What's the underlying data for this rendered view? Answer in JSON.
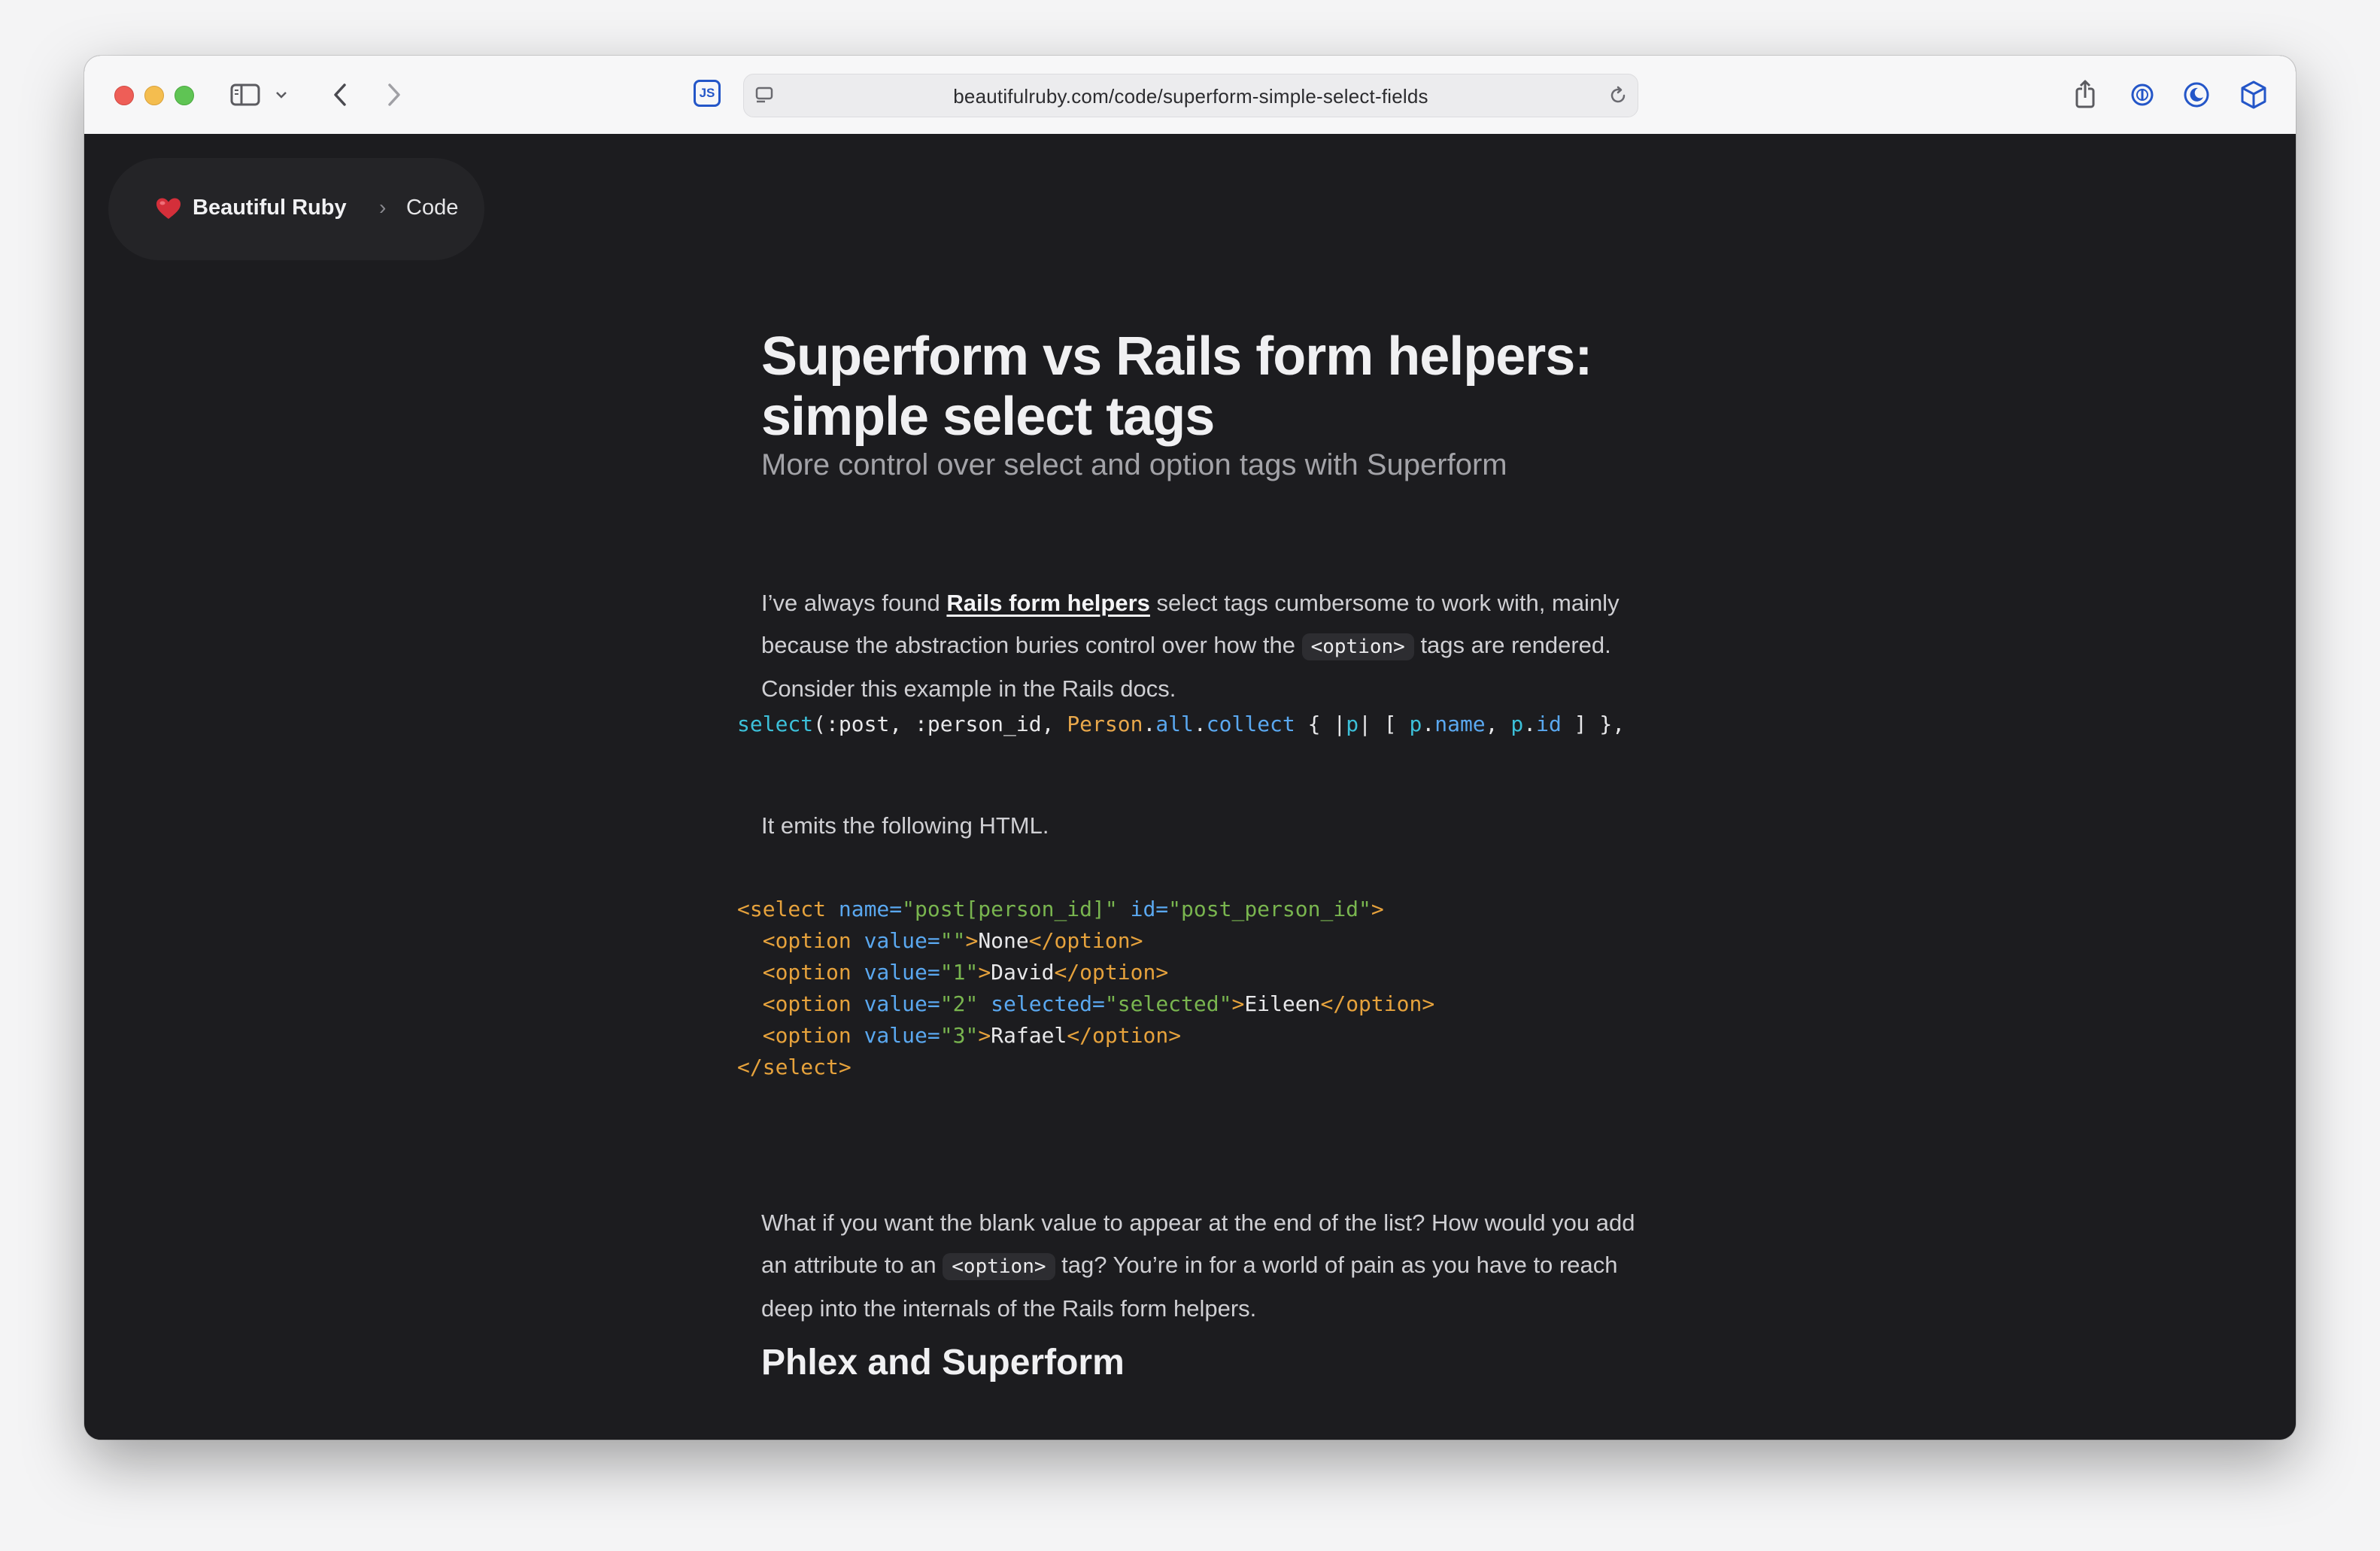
{
  "browser": {
    "url": "beautifulruby.com/code/superform-simple-select-fields",
    "js_badge": "JS",
    "icons": [
      "sidebar-icon",
      "chevron-down-icon",
      "back-icon",
      "forward-icon",
      "page-settings-icon",
      "reload-icon",
      "share-icon",
      "password-icon",
      "dark-mode-icon",
      "extension-cube-icon"
    ]
  },
  "breadcrumb": {
    "brand": "Beautiful Ruby",
    "separator": "›",
    "current": "Code"
  },
  "article": {
    "title": "Superform vs Rails form helpers: simple select tags",
    "subtitle": "More control over select and option tags with Superform",
    "p1": {
      "before": "I’ve always found ",
      "link": "Rails form helpers",
      "middle": " select tags cumbersome to work with, mainly because the abstraction buries control over how the ",
      "code": "<option>",
      "after": " tags are rendered. Consider this example in the Rails docs."
    },
    "code1": {
      "fn": "select",
      "args": "(:post, :person_id, ",
      "const": "Person",
      "dot1": ".",
      "m1": "all",
      "dot2": ".",
      "m2": "collect",
      "block_open": " { |",
      "bp": "p",
      "block_mid": "| [ ",
      "p1": "p",
      "d3": ".",
      "m3": "name",
      "comma": ", ",
      "p2": "p",
      "d4": ".",
      "m4": "id",
      "close": " ] },"
    },
    "p2": "It emits the following HTML.",
    "code2": {
      "l1": {
        "open": "<select ",
        "a1": "name=",
        "v1": "\"post[person_id]\"",
        "sp": " ",
        "a2": "id=",
        "v2": "\"post_person_id\"",
        "close": ">"
      },
      "l2": {
        "open": "  <option ",
        "a1": "value=",
        "v1": "\"\"",
        "gt": ">",
        "text": "None",
        "end": "</option>"
      },
      "l3": {
        "open": "  <option ",
        "a1": "value=",
        "v1": "\"1\"",
        "gt": ">",
        "text": "David",
        "end": "</option>"
      },
      "l4": {
        "open": "  <option ",
        "a1": "value=",
        "v1": "\"2\"",
        "sp": " ",
        "a2": "selected=",
        "v2": "\"selected\"",
        "gt": ">",
        "text": "Eileen",
        "end": "</option>"
      },
      "l5": {
        "open": "  <option ",
        "a1": "value=",
        "v1": "\"3\"",
        "gt": ">",
        "text": "Rafael",
        "end": "</option>"
      },
      "l6": "</select>"
    },
    "p3": {
      "before": "What if you want the blank value to appear at the end of the list? How would you add an attribute to an ",
      "code": "<option>",
      "after": " tag? You’re in for a world of pain as you have to reach deep into the internals of the Rails form helpers."
    },
    "h2": "Phlex and Superform"
  }
}
